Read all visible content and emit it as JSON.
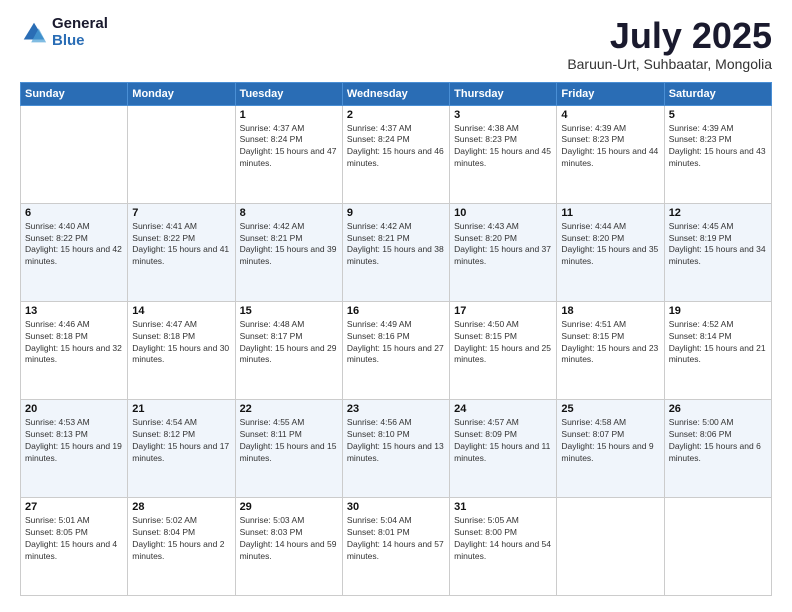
{
  "logo": {
    "general": "General",
    "blue": "Blue"
  },
  "title": "July 2025",
  "subtitle": "Baruun-Urt, Suhbaatar, Mongolia",
  "headers": [
    "Sunday",
    "Monday",
    "Tuesday",
    "Wednesday",
    "Thursday",
    "Friday",
    "Saturday"
  ],
  "weeks": [
    [
      {
        "day": "",
        "info": ""
      },
      {
        "day": "",
        "info": ""
      },
      {
        "day": "1",
        "info": "Sunrise: 4:37 AM\nSunset: 8:24 PM\nDaylight: 15 hours and 47 minutes."
      },
      {
        "day": "2",
        "info": "Sunrise: 4:37 AM\nSunset: 8:24 PM\nDaylight: 15 hours and 46 minutes."
      },
      {
        "day": "3",
        "info": "Sunrise: 4:38 AM\nSunset: 8:23 PM\nDaylight: 15 hours and 45 minutes."
      },
      {
        "day": "4",
        "info": "Sunrise: 4:39 AM\nSunset: 8:23 PM\nDaylight: 15 hours and 44 minutes."
      },
      {
        "day": "5",
        "info": "Sunrise: 4:39 AM\nSunset: 8:23 PM\nDaylight: 15 hours and 43 minutes."
      }
    ],
    [
      {
        "day": "6",
        "info": "Sunrise: 4:40 AM\nSunset: 8:22 PM\nDaylight: 15 hours and 42 minutes."
      },
      {
        "day": "7",
        "info": "Sunrise: 4:41 AM\nSunset: 8:22 PM\nDaylight: 15 hours and 41 minutes."
      },
      {
        "day": "8",
        "info": "Sunrise: 4:42 AM\nSunset: 8:21 PM\nDaylight: 15 hours and 39 minutes."
      },
      {
        "day": "9",
        "info": "Sunrise: 4:42 AM\nSunset: 8:21 PM\nDaylight: 15 hours and 38 minutes."
      },
      {
        "day": "10",
        "info": "Sunrise: 4:43 AM\nSunset: 8:20 PM\nDaylight: 15 hours and 37 minutes."
      },
      {
        "day": "11",
        "info": "Sunrise: 4:44 AM\nSunset: 8:20 PM\nDaylight: 15 hours and 35 minutes."
      },
      {
        "day": "12",
        "info": "Sunrise: 4:45 AM\nSunset: 8:19 PM\nDaylight: 15 hours and 34 minutes."
      }
    ],
    [
      {
        "day": "13",
        "info": "Sunrise: 4:46 AM\nSunset: 8:18 PM\nDaylight: 15 hours and 32 minutes."
      },
      {
        "day": "14",
        "info": "Sunrise: 4:47 AM\nSunset: 8:18 PM\nDaylight: 15 hours and 30 minutes."
      },
      {
        "day": "15",
        "info": "Sunrise: 4:48 AM\nSunset: 8:17 PM\nDaylight: 15 hours and 29 minutes."
      },
      {
        "day": "16",
        "info": "Sunrise: 4:49 AM\nSunset: 8:16 PM\nDaylight: 15 hours and 27 minutes."
      },
      {
        "day": "17",
        "info": "Sunrise: 4:50 AM\nSunset: 8:15 PM\nDaylight: 15 hours and 25 minutes."
      },
      {
        "day": "18",
        "info": "Sunrise: 4:51 AM\nSunset: 8:15 PM\nDaylight: 15 hours and 23 minutes."
      },
      {
        "day": "19",
        "info": "Sunrise: 4:52 AM\nSunset: 8:14 PM\nDaylight: 15 hours and 21 minutes."
      }
    ],
    [
      {
        "day": "20",
        "info": "Sunrise: 4:53 AM\nSunset: 8:13 PM\nDaylight: 15 hours and 19 minutes."
      },
      {
        "day": "21",
        "info": "Sunrise: 4:54 AM\nSunset: 8:12 PM\nDaylight: 15 hours and 17 minutes."
      },
      {
        "day": "22",
        "info": "Sunrise: 4:55 AM\nSunset: 8:11 PM\nDaylight: 15 hours and 15 minutes."
      },
      {
        "day": "23",
        "info": "Sunrise: 4:56 AM\nSunset: 8:10 PM\nDaylight: 15 hours and 13 minutes."
      },
      {
        "day": "24",
        "info": "Sunrise: 4:57 AM\nSunset: 8:09 PM\nDaylight: 15 hours and 11 minutes."
      },
      {
        "day": "25",
        "info": "Sunrise: 4:58 AM\nSunset: 8:07 PM\nDaylight: 15 hours and 9 minutes."
      },
      {
        "day": "26",
        "info": "Sunrise: 5:00 AM\nSunset: 8:06 PM\nDaylight: 15 hours and 6 minutes."
      }
    ],
    [
      {
        "day": "27",
        "info": "Sunrise: 5:01 AM\nSunset: 8:05 PM\nDaylight: 15 hours and 4 minutes."
      },
      {
        "day": "28",
        "info": "Sunrise: 5:02 AM\nSunset: 8:04 PM\nDaylight: 15 hours and 2 minutes."
      },
      {
        "day": "29",
        "info": "Sunrise: 5:03 AM\nSunset: 8:03 PM\nDaylight: 14 hours and 59 minutes."
      },
      {
        "day": "30",
        "info": "Sunrise: 5:04 AM\nSunset: 8:01 PM\nDaylight: 14 hours and 57 minutes."
      },
      {
        "day": "31",
        "info": "Sunrise: 5:05 AM\nSunset: 8:00 PM\nDaylight: 14 hours and 54 minutes."
      },
      {
        "day": "",
        "info": ""
      },
      {
        "day": "",
        "info": ""
      }
    ]
  ]
}
